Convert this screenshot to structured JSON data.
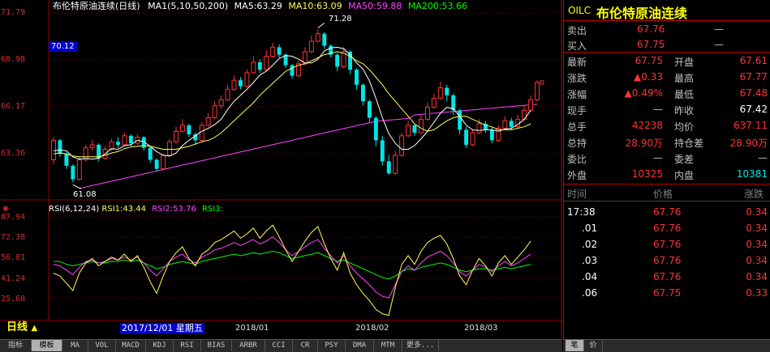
{
  "chart_title": {
    "name": "布伦特原油连续",
    "period": "(日线)",
    "ma_label": "MA1(5,10,50,200)",
    "ma5": "MA5:63.29",
    "ma10": "MA10:63.09",
    "ma50": "MA50:59.88",
    "ma200": "MA200:53.66"
  },
  "price_axis": [
    "71.79",
    "68.98",
    "66.17",
    "63.36"
  ],
  "rsi_axis": [
    "87.94",
    "72.38",
    "56.81",
    "41.24",
    "25.68"
  ],
  "current_price_box": "70.12",
  "high_annot": "71.28",
  "low_annot": "61.08",
  "rsi_title": {
    "label": "RSI(6,12,24)",
    "rsi1": "RSI1:43.44",
    "rsi2": "RSI2:53.76",
    "rsi3": "RSI3:"
  },
  "date_bar": {
    "period_label": "日线",
    "cursor_date": "2017/12/01 星期五",
    "months": [
      "2018/01",
      "2018/02",
      "2018/03"
    ]
  },
  "bottom_tabs": [
    "指标",
    "模板",
    "MA",
    "VOL",
    "MACD",
    "KDJ",
    "RSI",
    "BIAS",
    "ARBR",
    "CCI",
    "CR",
    "PSY",
    "DMA",
    "MTM",
    "更多..."
  ],
  "quote_panel": {
    "code": "OILC",
    "name": "布伦特原油连续",
    "sell_label": "卖出",
    "sell": "67.76",
    "sell_vol": "—",
    "buy_label": "买入",
    "buy": "67.75",
    "buy_vol": "—",
    "rows": [
      {
        "l1": "最新",
        "v1": "67.75",
        "l2": "开盘",
        "v2": "67.61"
      },
      {
        "l1": "涨跌",
        "v1": "▲0.33",
        "l2": "最高",
        "v2": "67.77"
      },
      {
        "l1": "涨幅",
        "v1": "▲0.49%",
        "l2": "最低",
        "v2": "67.48"
      },
      {
        "l1": "现手",
        "v1": "—",
        "l2": "昨收",
        "v2": "67.42"
      },
      {
        "l1": "总手",
        "v1": "42238",
        "l2": "均价",
        "v2": "637.11"
      },
      {
        "l1": "总持",
        "v1": "28.90万",
        "l2": "持仓差",
        "v2": "28.90万"
      },
      {
        "l1": "委比",
        "v1": "—",
        "l2": "委差",
        "v2": "—"
      },
      {
        "l1": "外盘",
        "v1": "10325",
        "l2": "内盘",
        "v2": "10381"
      }
    ],
    "tick_headers": [
      "时间",
      "价格",
      "涨跌"
    ],
    "ticks": [
      {
        "t": "17:38",
        "p": "67.76",
        "c": "0.34"
      },
      {
        "t": ".01",
        "p": "67.76",
        "c": "0.34"
      },
      {
        "t": ".02",
        "p": "67.76",
        "c": "0.34"
      },
      {
        "t": ".03",
        "p": "67.76",
        "c": "0.34"
      },
      {
        "t": ".04",
        "p": "67.76",
        "c": "0.34"
      },
      {
        "t": ".06",
        "p": "67.75",
        "c": "0.33"
      }
    ],
    "bottom_tabs": [
      "笔",
      "价"
    ]
  },
  "colors": {
    "up": "#ff3333",
    "down": "#00e5e5",
    "ma5": "#ffffff",
    "ma10": "#ffff55",
    "ma50": "#ff44ff",
    "ma200": "#00ff00",
    "grid": "#8b0000"
  },
  "chart_data": {
    "type": "candlestick",
    "y_range": [
      60.2,
      72.6
    ],
    "candles": [
      [
        62.6,
        63.9,
        64.1,
        62.3
      ],
      [
        63.9,
        63.0,
        64.0,
        62.8
      ],
      [
        63.0,
        62.2,
        63.1,
        62.0
      ],
      [
        62.2,
        61.3,
        62.3,
        61.1
      ],
      [
        61.3,
        62.6,
        62.8,
        61.2
      ],
      [
        62.6,
        63.4,
        63.6,
        62.5
      ],
      [
        63.4,
        63.6,
        63.9,
        63.2
      ],
      [
        63.6,
        62.7,
        63.7,
        62.5
      ],
      [
        62.7,
        63.3,
        63.5,
        62.6
      ],
      [
        63.3,
        63.8,
        64.0,
        63.2
      ],
      [
        63.8,
        63.6,
        64.1,
        63.4
      ],
      [
        63.6,
        64.2,
        64.4,
        63.5
      ],
      [
        64.2,
        63.7,
        64.3,
        63.5
      ],
      [
        63.7,
        64.1,
        64.3,
        63.6
      ],
      [
        64.1,
        63.4,
        64.2,
        63.2
      ],
      [
        63.4,
        62.6,
        63.5,
        62.4
      ],
      [
        62.6,
        62.0,
        62.7,
        61.8
      ],
      [
        62.0,
        62.9,
        63.0,
        61.9
      ],
      [
        62.9,
        63.8,
        64.0,
        62.8
      ],
      [
        63.8,
        64.5,
        64.8,
        63.7
      ],
      [
        64.5,
        64.9,
        65.3,
        64.4
      ],
      [
        64.9,
        64.3,
        65.0,
        64.1
      ],
      [
        64.3,
        63.9,
        64.4,
        63.6
      ],
      [
        63.9,
        64.9,
        65.1,
        63.8
      ],
      [
        64.9,
        65.4,
        65.7,
        64.8
      ],
      [
        65.4,
        66.2,
        66.5,
        65.3
      ],
      [
        66.2,
        66.6,
        66.9,
        66.0
      ],
      [
        66.6,
        67.3,
        67.6,
        66.5
      ],
      [
        67.3,
        67.9,
        68.2,
        67.2
      ],
      [
        67.9,
        67.5,
        68.1,
        67.3
      ],
      [
        67.5,
        68.4,
        68.6,
        67.4
      ],
      [
        68.4,
        69.1,
        69.5,
        68.3
      ],
      [
        69.1,
        68.6,
        69.3,
        68.4
      ],
      [
        68.6,
        69.5,
        69.9,
        68.5
      ],
      [
        69.5,
        70.1,
        70.4,
        69.4
      ],
      [
        70.1,
        69.6,
        70.3,
        69.4
      ],
      [
        69.6,
        68.9,
        69.7,
        68.7
      ],
      [
        68.9,
        68.2,
        69.0,
        68.0
      ],
      [
        68.2,
        69.0,
        69.2,
        68.1
      ],
      [
        69.0,
        69.8,
        70.1,
        68.9
      ],
      [
        69.8,
        70.5,
        70.9,
        69.7
      ],
      [
        70.5,
        71.0,
        71.28,
        70.4
      ],
      [
        71.0,
        70.2,
        71.1,
        70.0
      ],
      [
        70.2,
        69.6,
        70.3,
        69.4
      ],
      [
        69.6,
        68.8,
        69.7,
        68.5
      ],
      [
        68.8,
        69.8,
        70.1,
        68.7
      ],
      [
        69.8,
        68.6,
        69.9,
        68.3
      ],
      [
        68.6,
        67.6,
        68.7,
        67.3
      ],
      [
        67.6,
        66.5,
        67.7,
        66.2
      ],
      [
        66.5,
        65.4,
        66.6,
        65.1
      ],
      [
        65.4,
        63.9,
        65.5,
        63.5
      ],
      [
        63.9,
        62.5,
        64.2,
        62.2
      ],
      [
        62.5,
        61.7,
        62.9,
        61.6
      ],
      [
        61.7,
        62.9,
        63.2,
        61.6
      ],
      [
        62.9,
        64.2,
        64.4,
        62.8
      ],
      [
        64.2,
        64.9,
        65.2,
        64.1
      ],
      [
        64.9,
        64.4,
        65.0,
        64.2
      ],
      [
        64.4,
        65.3,
        65.6,
        64.3
      ],
      [
        65.3,
        66.1,
        66.4,
        65.2
      ],
      [
        66.1,
        66.7,
        67.0,
        66.0
      ],
      [
        66.7,
        67.4,
        67.8,
        66.6
      ],
      [
        67.4,
        66.9,
        67.6,
        66.5
      ],
      [
        66.9,
        65.9,
        67.0,
        65.6
      ],
      [
        65.9,
        64.6,
        66.0,
        64.3
      ],
      [
        64.6,
        63.6,
        64.8,
        63.4
      ],
      [
        63.6,
        64.4,
        64.6,
        63.5
      ],
      [
        64.4,
        65.0,
        65.3,
        64.3
      ],
      [
        65.0,
        64.6,
        65.2,
        64.4
      ],
      [
        64.6,
        63.9,
        64.8,
        63.7
      ],
      [
        63.9,
        64.7,
        64.9,
        63.8
      ],
      [
        64.7,
        65.2,
        65.5,
        64.6
      ],
      [
        65.2,
        64.8,
        65.4,
        64.6
      ],
      [
        64.8,
        65.3,
        65.6,
        64.7
      ],
      [
        65.3,
        65.9,
        66.2,
        65.2
      ],
      [
        65.9,
        66.6,
        66.9,
        65.8
      ],
      [
        66.6,
        67.75,
        67.9,
        66.5
      ]
    ],
    "ma_series": [
      {
        "name": "MA5",
        "values": [
          63.2,
          63.25,
          63.2,
          62.8,
          62.65,
          62.7,
          62.65,
          62.7,
          63.0,
          63.35,
          63.3,
          63.55,
          63.6,
          63.9,
          63.8,
          63.5,
          63.15,
          62.9,
          62.85,
          63.05,
          63.55,
          63.9,
          64.2,
          64.5,
          64.7,
          64.95,
          65.3,
          65.95,
          66.5,
          66.9,
          67.3,
          67.75,
          68.25,
          68.5,
          68.9,
          69.35,
          69.55,
          69.5,
          69.3,
          69.05,
          69.05,
          69.3,
          69.85,
          70.05,
          70.1,
          70.0,
          69.6,
          69.05,
          68.65,
          67.85,
          66.7,
          65.4,
          64.35,
          63.7,
          63.3,
          63.3,
          63.55,
          64.0,
          64.5,
          65.1,
          65.7,
          66.1,
          66.0,
          65.5,
          64.9,
          64.6,
          64.55,
          64.6,
          64.6,
          64.5,
          64.65,
          64.7,
          64.95,
          65.3,
          65.9
        ]
      },
      {
        "name": "MA10",
        "values": [
          63.0,
          63.05,
          63.0,
          62.85,
          62.8,
          62.8,
          62.8,
          62.8,
          62.9,
          63.05,
          63.15,
          63.35,
          63.45,
          63.5,
          63.55,
          63.5,
          63.4,
          63.3,
          63.3,
          63.3,
          63.4,
          63.5,
          63.65,
          63.8,
          63.9,
          64.1,
          64.4,
          64.8,
          65.2,
          65.6,
          66.0,
          66.4,
          66.9,
          67.3,
          67.7,
          68.1,
          68.5,
          68.7,
          68.9,
          69.0,
          69.2,
          69.4,
          69.6,
          69.7,
          69.8,
          69.7,
          69.5,
          69.2,
          69.0,
          68.6,
          68.1,
          67.6,
          67.0,
          66.5,
          66.0,
          65.5,
          65.0,
          64.7,
          64.5,
          64.6,
          64.9,
          65.2,
          65.4,
          65.5,
          65.5,
          65.3,
          65.1,
          64.9,
          64.8,
          64.6,
          64.6,
          64.6,
          64.7,
          64.8,
          65.0
        ]
      },
      {
        "name": "MA50",
        "values": [
          null,
          null,
          null,
          null,
          null,
          null,
          null,
          null,
          null,
          null,
          null,
          null,
          null,
          null,
          null,
          null,
          null,
          null,
          null,
          null,
          null,
          null,
          null,
          null,
          null,
          null,
          null,
          null,
          null,
          null,
          null,
          null,
          null,
          null,
          null,
          null,
          null,
          null,
          null,
          null,
          null,
          null,
          null,
          null,
          null,
          null,
          null,
          null,
          null,
          null,
          null,
          null,
          null,
          null,
          null,
          null,
          null,
          null,
          null,
          null,
          null,
          null,
          null,
          null,
          null,
          null,
          null,
          null,
          null,
          null,
          null,
          null,
          null,
          null,
          null
        ]
      },
      {
        "name": "MA200",
        "values": []
      }
    ],
    "rsi": {
      "y_range": [
        18,
        92
      ],
      "rsi1": [
        50,
        48,
        43,
        38,
        50,
        57,
        60,
        55,
        58,
        61,
        59,
        63,
        58,
        62,
        54,
        44,
        36,
        48,
        58,
        64,
        68,
        60,
        55,
        63,
        66,
        71,
        73,
        76,
        79,
        74,
        77,
        81,
        74,
        79,
        83,
        75,
        66,
        58,
        65,
        72,
        78,
        82,
        70,
        60,
        52,
        64,
        50,
        42,
        36,
        31,
        25,
        22,
        21,
        40,
        56,
        62,
        56,
        65,
        71,
        74,
        76,
        70,
        60,
        48,
        42,
        52,
        60,
        55,
        48,
        57,
        62,
        56,
        61,
        66,
        72
      ],
      "rsi2": [
        56,
        55,
        52,
        49,
        54,
        58,
        59,
        57,
        58,
        60,
        59,
        61,
        59,
        61,
        57,
        52,
        48,
        53,
        58,
        61,
        63,
        59,
        57,
        61,
        63,
        66,
        67,
        69,
        71,
        69,
        71,
        73,
        70,
        72,
        75,
        71,
        66,
        62,
        65,
        68,
        71,
        73,
        67,
        62,
        57,
        62,
        55,
        50,
        46,
        42,
        37,
        34,
        33,
        42,
        51,
        55,
        52,
        57,
        61,
        63,
        65,
        62,
        57,
        51,
        48,
        52,
        56,
        54,
        51,
        55,
        58,
        55,
        57,
        60,
        63
      ],
      "rsi3": [
        58,
        58,
        56,
        55,
        56,
        57,
        58,
        57,
        57,
        58,
        58,
        59,
        58,
        59,
        57,
        55,
        53,
        54,
        56,
        57,
        58,
        57,
        56,
        58,
        59,
        60,
        61,
        62,
        63,
        62,
        63,
        64,
        63,
        64,
        65,
        64,
        62,
        60,
        61,
        62,
        63,
        64,
        62,
        60,
        58,
        59,
        57,
        55,
        53,
        51,
        49,
        47,
        46,
        48,
        51,
        53,
        52,
        54,
        55,
        56,
        57,
        56,
        54,
        52,
        51,
        52,
        53,
        53,
        52,
        53,
        54,
        53,
        54,
        55,
        56
      ]
    }
  }
}
